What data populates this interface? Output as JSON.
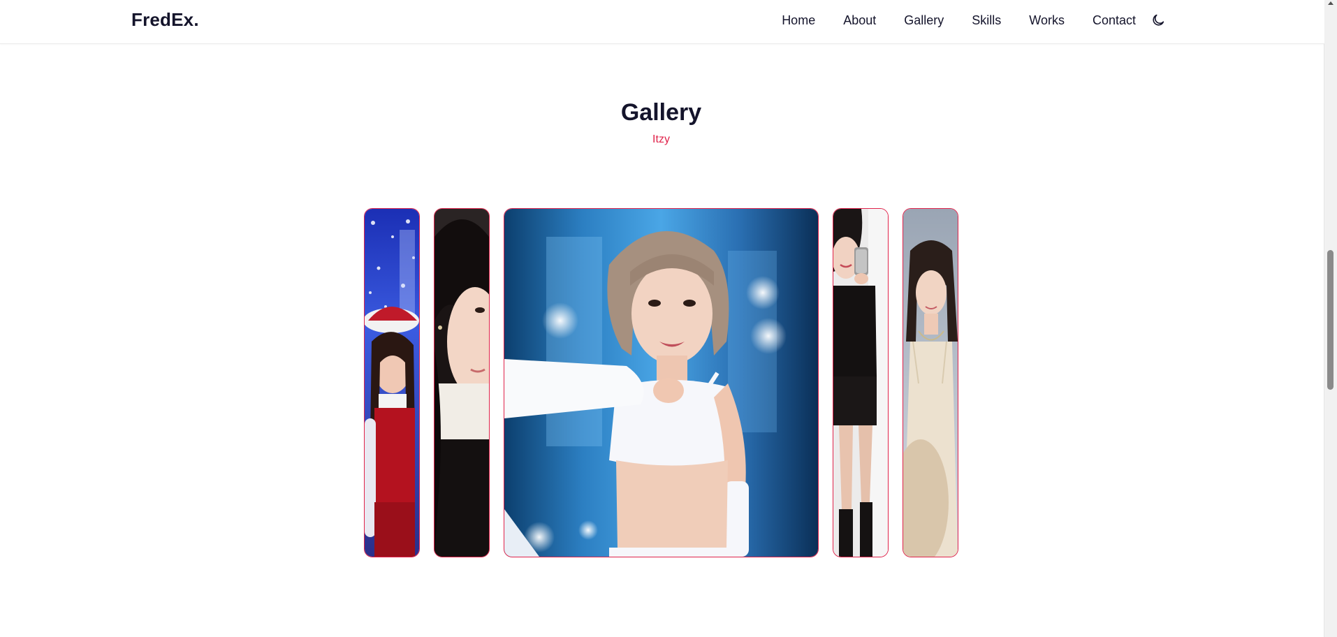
{
  "header": {
    "logo": "FredEx.",
    "nav": [
      "Home",
      "About",
      "Gallery",
      "Skills",
      "Works",
      "Contact"
    ],
    "theme_icon": "moon-icon"
  },
  "gallery": {
    "title": "Gallery",
    "subtitle": "Itzy",
    "cards": [
      {
        "name": "photo-christmas",
        "desc": "red outfit blue snow"
      },
      {
        "name": "photo-closeup",
        "desc": "black hair white top"
      },
      {
        "name": "photo-stage",
        "desc": "white crop top stage blue"
      },
      {
        "name": "photo-mirror-selfie",
        "desc": "black outfit phone"
      },
      {
        "name": "photo-satin-dress",
        "desc": "champagne slip dress"
      }
    ]
  },
  "colors": {
    "accent": "#e0224a",
    "text": "#14142b",
    "background": "#ffffff"
  }
}
